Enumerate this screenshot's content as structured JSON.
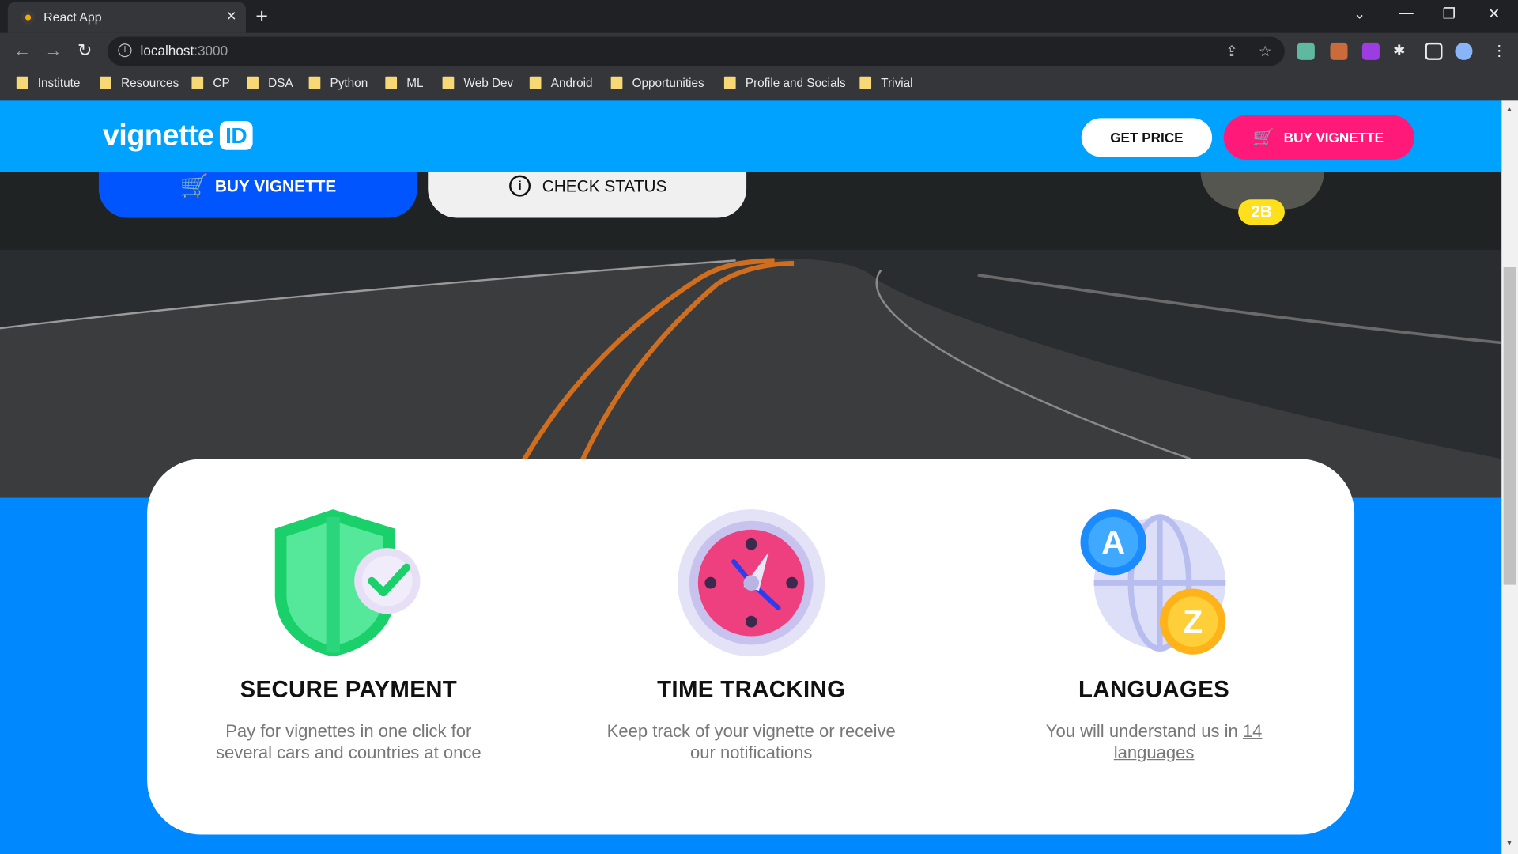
{
  "browser": {
    "tab_title": "React App",
    "url_host": "localhost",
    "url_port": ":3000",
    "bookmarks": [
      "Institute",
      "Resources",
      "CP",
      "DSA",
      "Python",
      "ML",
      "Web Dev",
      "Android",
      "Opportunities",
      "Profile and Socials",
      "Trivial"
    ]
  },
  "header": {
    "logo_text": "vignette",
    "logo_badge": "ID",
    "get_price_label": "GET PRICE",
    "buy_label": "BUY VIGNETTE"
  },
  "hero": {
    "buy_label": "BUY VIGNETTE",
    "check_label": "CHECK STATUS",
    "badge": "2B"
  },
  "features": [
    {
      "title": "SECURE PAYMENT",
      "text": "Pay for vignettes in one click for several cars and countries at once",
      "icon": "shield-check-icon"
    },
    {
      "title": "TIME TRACKING",
      "text": "Keep track of your vignette or receive our notifications",
      "icon": "clock-icon"
    },
    {
      "title": "LANGUAGES",
      "text_prefix": "You will understand us in ",
      "link": "14 languages",
      "icon": "globe-languages-icon"
    }
  ],
  "colors": {
    "header_bg": "#00a2ff",
    "accent_pink": "#ff1a7a",
    "hero_button_blue": "#0055ff",
    "section_blue": "#0088ff"
  }
}
